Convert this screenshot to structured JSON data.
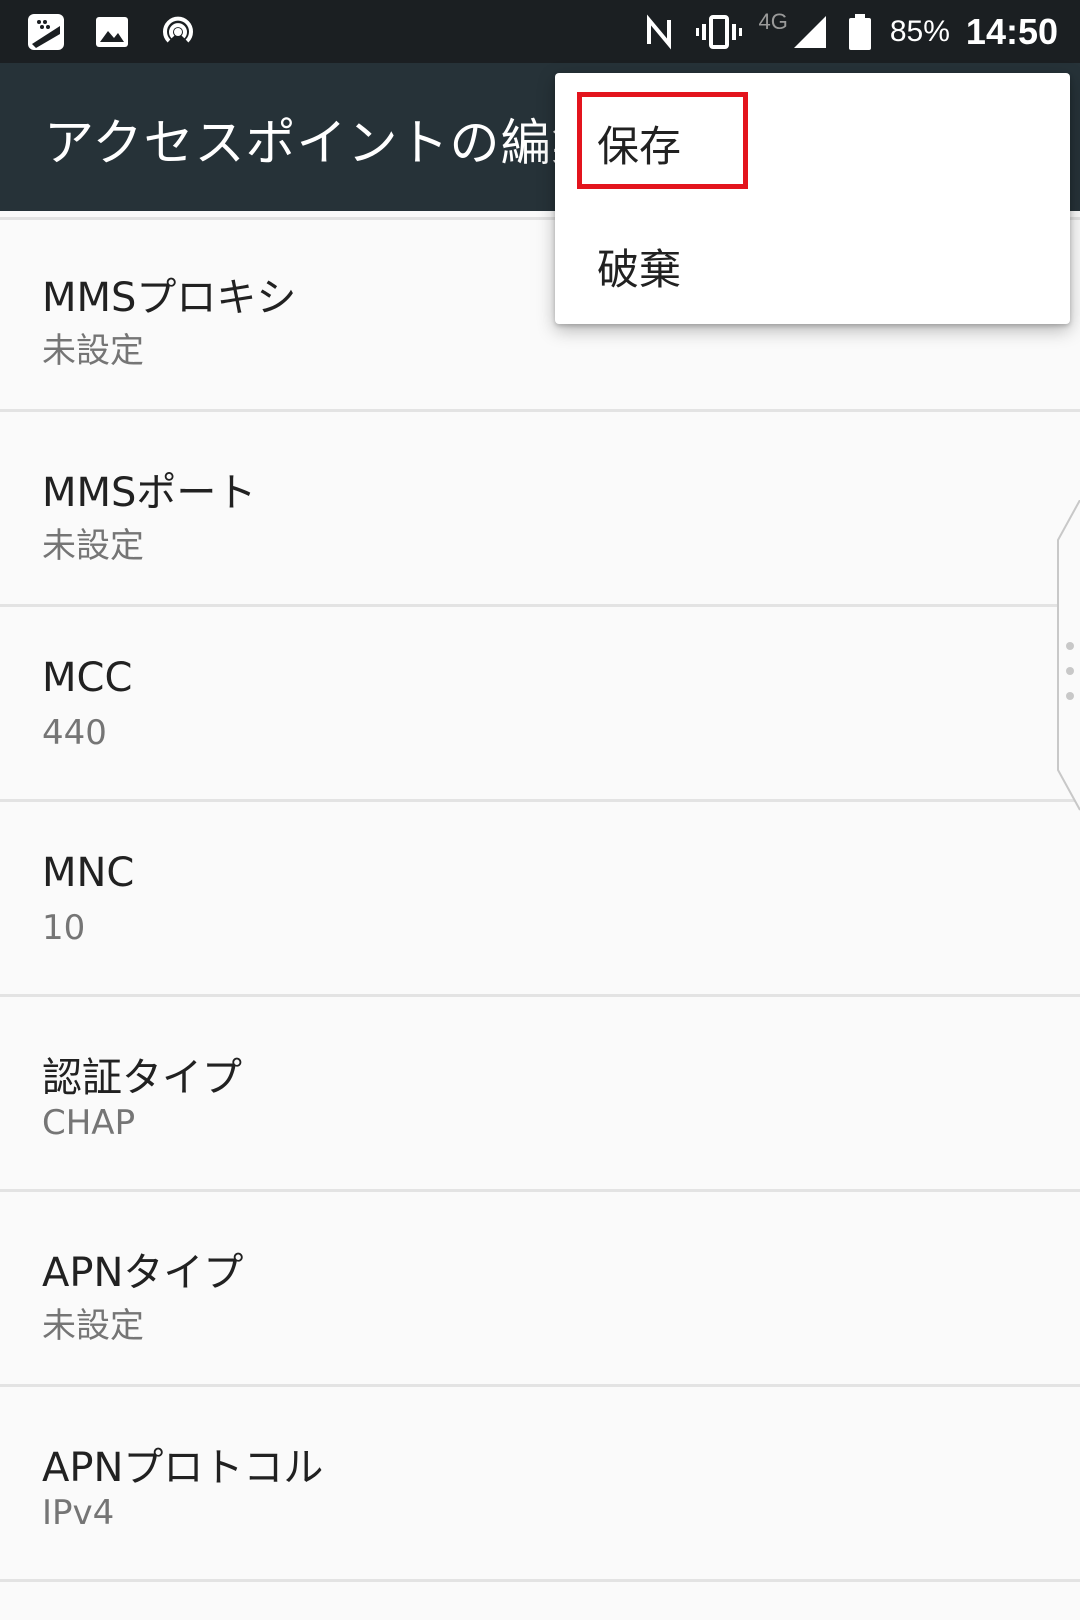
{
  "status_bar": {
    "left_icons": [
      "blackberry-icon",
      "image-icon",
      "hotspot-icon"
    ],
    "right_icons": [
      "nfc-icon",
      "vibrate-icon",
      "signal-icon",
      "battery-icon"
    ],
    "network_label": "4G",
    "battery_percent": "85%",
    "time": "14:50"
  },
  "toolbar": {
    "title": "アクセスポイントの編集"
  },
  "menu": {
    "items": [
      {
        "label": "保存"
      },
      {
        "label": "破棄"
      }
    ],
    "highlight_color": "#e3141d"
  },
  "list": {
    "items": [
      {
        "title": "MMSプロキシ",
        "value": "未設定"
      },
      {
        "title": "MMSポート",
        "value": "未設定"
      },
      {
        "title": "MCC",
        "value": "440"
      },
      {
        "title": "MNC",
        "value": "10"
      },
      {
        "title": "認証タイプ",
        "value": "CHAP"
      },
      {
        "title": "APNタイプ",
        "value": "未設定"
      },
      {
        "title": "APNプロトコル",
        "value": "IPv4"
      }
    ]
  },
  "colors": {
    "status_bar_bg": "#1b1f22",
    "toolbar_bg": "#263238",
    "list_bg": "#fafafa"
  }
}
